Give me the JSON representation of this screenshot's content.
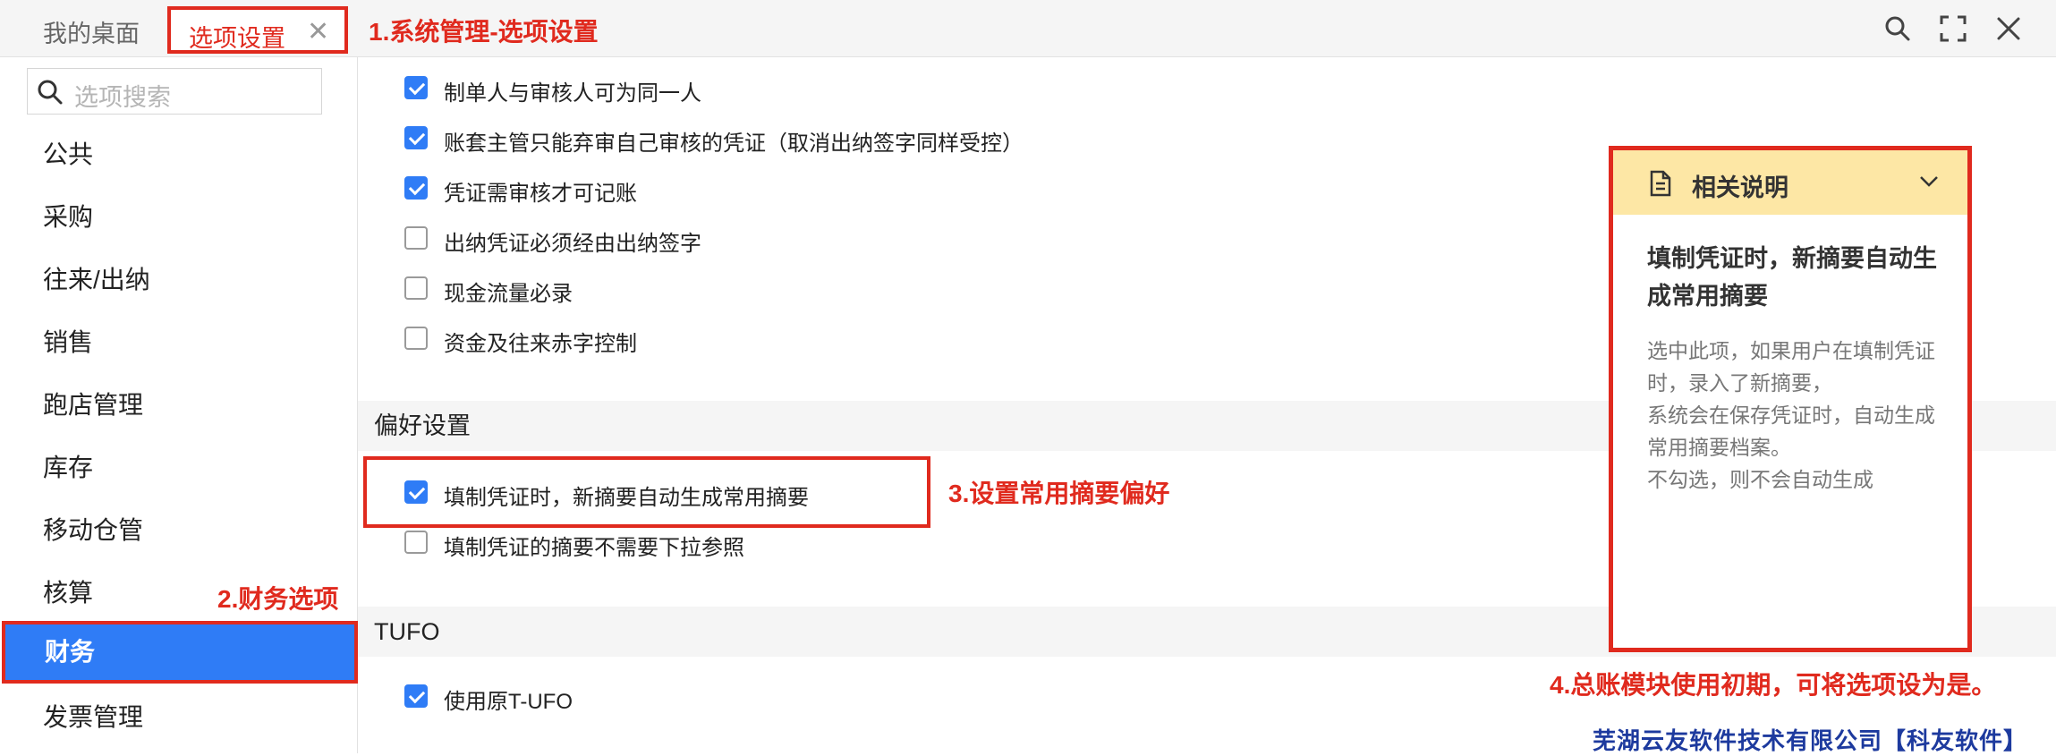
{
  "tabs": {
    "home": "我的桌面",
    "active": "选项设置",
    "close_glyph": "✕"
  },
  "annotations": {
    "step1": "1.系统管理-选项设置",
    "step2": "2.财务选项",
    "step3": "3.设置常用摘要偏好",
    "step4": "4.总账模块使用初期，可将选项设为是。"
  },
  "top_icons": [
    "search-icon",
    "fullscreen-icon",
    "close-icon"
  ],
  "sidebar": {
    "search_placeholder": "选项搜索",
    "items": [
      {
        "label": "公共",
        "active": false
      },
      {
        "label": "采购",
        "active": false
      },
      {
        "label": "往来/出纳",
        "active": false
      },
      {
        "label": "销售",
        "active": false
      },
      {
        "label": "跑店管理",
        "active": false
      },
      {
        "label": "库存",
        "active": false
      },
      {
        "label": "移动仓管",
        "active": false
      },
      {
        "label": "核算",
        "active": false
      },
      {
        "label": "财务",
        "active": true
      },
      {
        "label": "发票管理",
        "active": false
      }
    ]
  },
  "options": [
    {
      "label": "制单人与审核人可为同一人",
      "checked": true
    },
    {
      "label": "账套主管只能弃审自己审核的凭证（取消出纳签字同样受控）",
      "checked": true
    },
    {
      "label": "凭证需审核才可记账",
      "checked": true
    },
    {
      "label": "出纳凭证必须经由出纳签字",
      "checked": false
    },
    {
      "label": "现金流量必录",
      "checked": false
    },
    {
      "label": "资金及往来赤字控制",
      "checked": false
    }
  ],
  "preferences": {
    "title": "偏好设置",
    "options": [
      {
        "label": "填制凭证时，新摘要自动生成常用摘要",
        "checked": true
      },
      {
        "label": "填制凭证的摘要不需要下拉参照",
        "checked": false
      }
    ]
  },
  "tufo": {
    "title": "TUFO",
    "options": [
      {
        "label": "使用原T-UFO",
        "checked": true
      }
    ]
  },
  "help": {
    "title": "相关说明",
    "heading": "填制凭证时，新摘要自动生成常用摘要",
    "lines": [
      "选中此项，如果用户在填制凭证时，录入了新摘要，",
      "系统会在保存凭证时，自动生成常用摘要档案。",
      "不勾选，则不会自动生成"
    ]
  },
  "watermark": "芜湖云友软件技术有限公司【科友软件】",
  "colors": {
    "accent": "#2f7cf6",
    "annotation": "#e02a1e",
    "help_header": "#fde7a5",
    "watermark": "#1d3a9e"
  }
}
